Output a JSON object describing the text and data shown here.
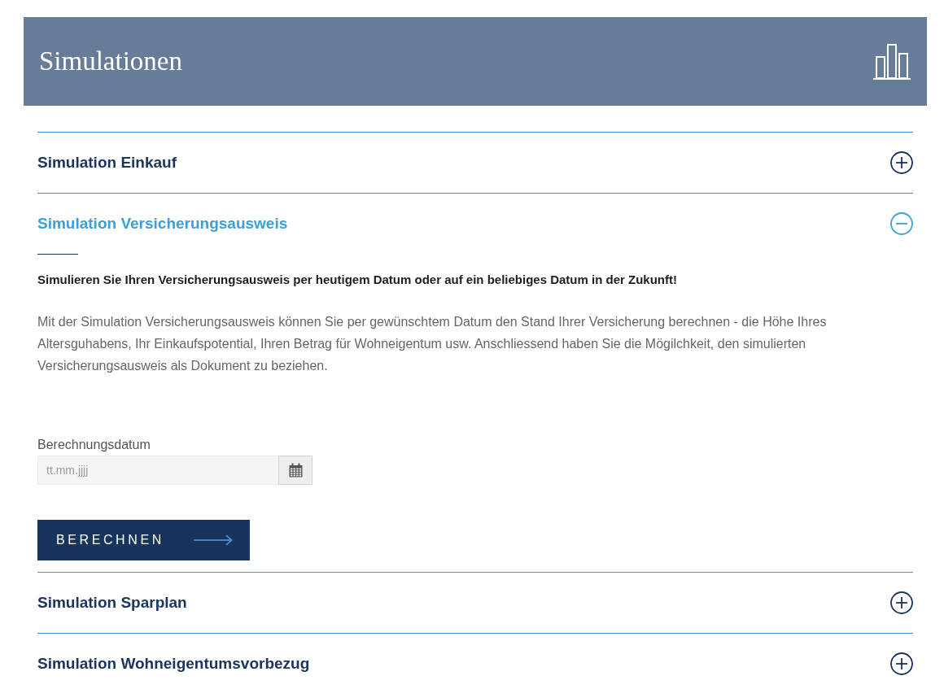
{
  "header": {
    "title": "Simulationen"
  },
  "accordion": [
    {
      "title": "Simulation Einkauf",
      "expanded": false
    },
    {
      "title": "Simulation Versicherungsausweis",
      "expanded": true,
      "content": {
        "intro": "Simulieren Sie Ihren Versicherungsausweis per heutigem Datum oder auf ein beliebiges Datum in der Zukunft!",
        "description": "Mit der Simulation Versicherungsausweis können Sie per gewünschtem Datum den Stand Ihrer Versicherung berechnen - die Höhe Ihres Altersguhabens, Ihr Einkaufspotential, Ihren Betrag für Wohneigentum usw. Anschliessend haben Sie die Mögilchkeit, den simulierten Versicherungsausweis als Dokument zu beziehen.",
        "date_field": {
          "label": "Berechnungsdatum",
          "placeholder": "tt.mm.jjjj"
        },
        "button": "BERECHNEN"
      }
    },
    {
      "title": "Simulation Sparplan",
      "expanded": false
    },
    {
      "title": "Simulation Wohneigentumsvorbezug",
      "expanded": false
    }
  ]
}
